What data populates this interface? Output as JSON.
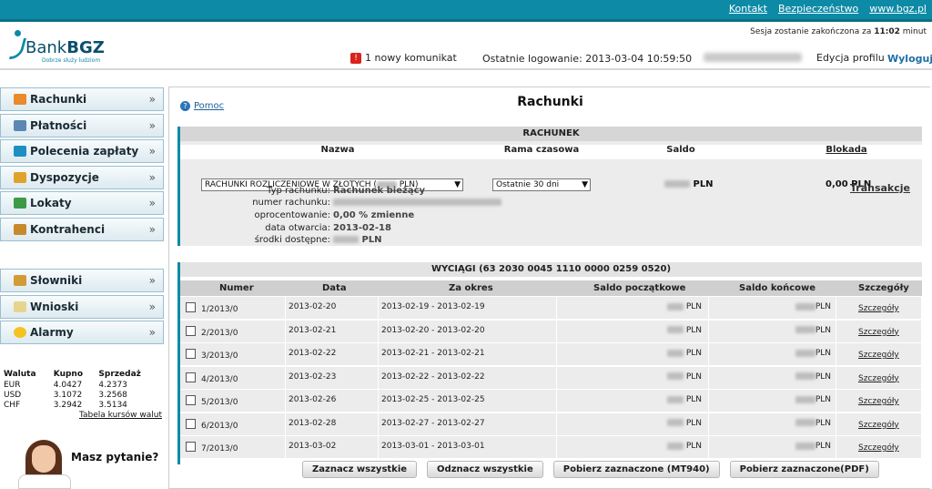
{
  "top_links": [
    "Kontakt",
    "Bezpieczeństwo",
    "www.bgz.pl"
  ],
  "logo": {
    "bank": "Bank",
    "brand": "BGZ",
    "tagline": "Dobrze służy ludziom"
  },
  "session": {
    "prefix": "Sesja zostanie zakończona za",
    "time": "11:02",
    "suffix": "minut"
  },
  "messages": "1 nowy komunikat",
  "last_login": "Ostatnie logowanie: 2013-03-04 10:59:50",
  "edit_profile": "Edycja profilu",
  "logout": "Wyloguj",
  "nav": [
    {
      "label": "Rachunki",
      "icon": "bar-chart-icon",
      "color": "#e98a2b"
    },
    {
      "label": "Płatności",
      "icon": "payment-icon",
      "color": "#5b87b5"
    },
    {
      "label": "Polecenia zapłaty",
      "icon": "direct-debit-icon",
      "color": "#1d8fc2"
    },
    {
      "label": "Dyspozycje",
      "icon": "pencil-icon",
      "color": "#e0a32a"
    },
    {
      "label": "Lokaty",
      "icon": "growth-chart-icon",
      "color": "#3c9b44"
    },
    {
      "label": "Kontrahenci",
      "icon": "contacts-icon",
      "color": "#c58a2c"
    }
  ],
  "nav2": [
    {
      "label": "Słowniki",
      "icon": "book-icon",
      "color": "#d39b36"
    },
    {
      "label": "Wnioski",
      "icon": "document-icon",
      "color": "#e7d58e"
    },
    {
      "label": "Alarmy",
      "icon": "bulb-icon",
      "color": "#f3c321"
    }
  ],
  "rates": {
    "headers": [
      "Waluta",
      "Kupno",
      "Sprzedaż"
    ],
    "rows": [
      [
        "EUR",
        "4.0427",
        "4.2373"
      ],
      [
        "USD",
        "3.1072",
        "3.2568"
      ],
      [
        "CHF",
        "3.2942",
        "3.5134"
      ]
    ],
    "link": "Tabela kursów walut"
  },
  "question": "Masz pytanie?",
  "help": "Pomoc",
  "page_title": "Rachunki",
  "account": {
    "header": "RACHUNEK",
    "col_name": "Nazwa",
    "col_range": "Rama czasowa",
    "col_balance": "Saldo",
    "col_block": "Blokada",
    "name_value_prefix": "RACHUNKI ROZLICZENIOWE W ZŁOTYCH (",
    "name_value_suffix": "PLN)",
    "range_value": "Ostatnie 30 dni",
    "balance_suffix": "PLN",
    "block_value": "0,00 PLN",
    "details": [
      {
        "label": "Typ rachunku:",
        "value": "Rachunek bieżący"
      },
      {
        "label": "numer rachunku:",
        "value": ""
      },
      {
        "label": "oprocentowanie:",
        "value": "0,00 % zmienne"
      },
      {
        "label": "data otwarcia:",
        "value": "2013-02-18"
      },
      {
        "label": "środki dostępne:",
        "value": "PLN"
      }
    ],
    "transactions": "Transakcje"
  },
  "statements": {
    "header": "WYCIĄGI (63 2030 0045 1110 0000 0259 0520)",
    "columns": [
      "Numer",
      "Data",
      "Za okres",
      "Saldo początkowe",
      "Saldo końcowe",
      "Szczegóły"
    ],
    "rows": [
      {
        "num": "1/2013/0",
        "date": "2013-02-20",
        "period": "2013-02-19 - 2013-02-19",
        "start": "PLN",
        "end": "PLN",
        "details": "Szczegóły"
      },
      {
        "num": "2/2013/0",
        "date": "2013-02-21",
        "period": "2013-02-20 - 2013-02-20",
        "start": "PLN",
        "end": "PLN",
        "details": "Szczegóły"
      },
      {
        "num": "3/2013/0",
        "date": "2013-02-22",
        "period": "2013-02-21 - 2013-02-21",
        "start": "PLN",
        "end": "PLN",
        "details": "Szczegóły"
      },
      {
        "num": "4/2013/0",
        "date": "2013-02-23",
        "period": "2013-02-22 - 2013-02-22",
        "start": "PLN",
        "end": "PLN",
        "details": "Szczegóły"
      },
      {
        "num": "5/2013/0",
        "date": "2013-02-26",
        "period": "2013-02-25 - 2013-02-25",
        "start": "PLN",
        "end": "PLN",
        "details": "Szczegóły"
      },
      {
        "num": "6/2013/0",
        "date": "2013-02-28",
        "period": "2013-02-27 - 2013-02-27",
        "start": "PLN",
        "end": "PLN",
        "details": "Szczegóły"
      },
      {
        "num": "7/2013/0",
        "date": "2013-03-02",
        "period": "2013-03-01 - 2013-03-01",
        "start": "PLN",
        "end": "PLN",
        "details": "Szczegóły"
      }
    ]
  },
  "buttons": [
    "Zaznacz wszystkie",
    "Odznacz wszystkie",
    "Pobierz zaznaczone (MT940)",
    "Pobierz zaznaczone(PDF)"
  ]
}
